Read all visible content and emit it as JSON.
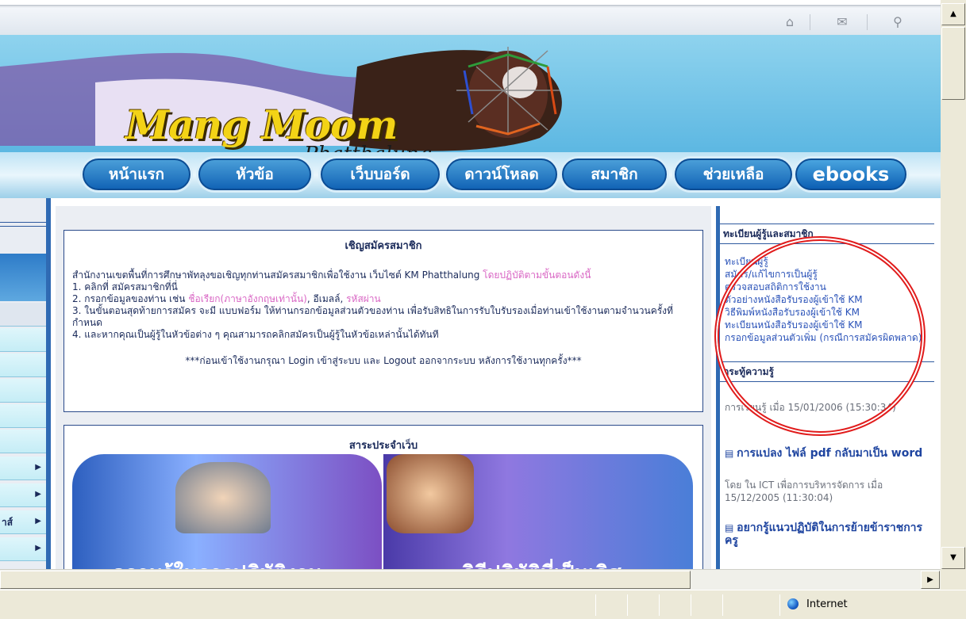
{
  "header": {
    "logo_main": "Mang Moom",
    "logo_sub": "Phatthalung"
  },
  "nav": [
    {
      "label": "หน้าแรก"
    },
    {
      "label": "หัวข้อ"
    },
    {
      "label": "เว็บบอร์ด"
    },
    {
      "label": "ดาวน์โหลด"
    },
    {
      "label": "สมาชิก"
    },
    {
      "label": "ช่วยเหลือ"
    },
    {
      "label": "ebooks"
    }
  ],
  "register_panel": {
    "title": "เชิญสมัครสมาชิก",
    "intro": "สำนักงานเขตพื้นที่การศึกษาพัทลุงขอเชิญทุกท่านสมัครสมาชิกเพื่อใช้งาน เว็บไซต์ KM Phatthalung",
    "intro_link": "โดยปฏิบัติตามขั้นตอนดังนี้",
    "step1": "1. คลิกที่ สมัครสมาชิกที่นี่",
    "step2_prefix": "2. กรอกข้อมูลของท่าน เช่น",
    "step2_name": "ชื่อเรียก(ภาษาอังกฤษเท่านั้น)",
    "step2_email": "อีเมลล์",
    "step2_pass": "รหัสผ่าน",
    "step3": "3. ในขั้นตอนสุดท้ายการสมัคร จะมี แบบฟอร์ม ให้ท่านกรอกข้อมูลส่วนตัวของท่าน เพื่อรับสิทธิในการรับใบรับรองเมื่อท่านเข้าใช้งานตามจำนวนครั้งที่กำหนด",
    "step4": "4. และหากคุณเป็นผู้รู้ในหัวข้อต่าง ๆ คุณสามารถคลิกสมัครเป็นผู้รู้ในหัวข้อเหล่านั้นได้ทันที",
    "notice": "***ก่อนเข้าใช้งานกรุณา Login เข้าสู่ระบบ และ Logout ออกจากระบบ หลังการใช้งานทุกครั้ง***"
  },
  "site_panel": {
    "title": "สาระประจำเว็บ",
    "banner_left": "ความรู้ในการปฏิบัติงาน",
    "banner_right": "วิธีปฏิบัติที่เป็นเลิศ"
  },
  "right": {
    "section1_title": "ทะเบียนผู้รู้และสมาชิก",
    "links": [
      "ทะเบียนผู้รู้",
      "สมัคร/แก้ไขการเป็นผู้รู้",
      "ตรวจสอบสถิติการใช้งาน",
      "ตัวอย่างหนังสือรับรองผู้เข้าใช้ KM",
      "วิธีพิมพ์หนังสือรับรองผู้เข้าใช้ KM",
      "ทะเบียนหนังสือรับรองผู้เข้าใช้ KM",
      "กรอกข้อมูลส่วนตัวเพิ่ม (กรณีการสมัครผิดพลาด)"
    ],
    "section2_title": "กระทู้ความรู้",
    "item1_text": "การเรียนรู้ เมื่อ 15/01/2006 (15:30:34)",
    "item2_title": "การแปลง ไฟล์ pdf กลับมาเป็น word",
    "item2_meta": "โดย ใน ICT เพื่อการบริหารจัดการ เมื่อ 15/12/2005 (11:30:04)",
    "item3_title": "อยากรู้แนวปฏิบัติในการย้ายข้าราชการครู"
  },
  "left": {
    "partial_text": "าส์"
  },
  "status": {
    "zone": "Internet"
  },
  "colors": {
    "nav_button": "#1264b6",
    "border_blue": "#2f6ab3",
    "pink": "#d966c4",
    "orange": "#e1781f",
    "annotation_red": "#e11c1c"
  }
}
